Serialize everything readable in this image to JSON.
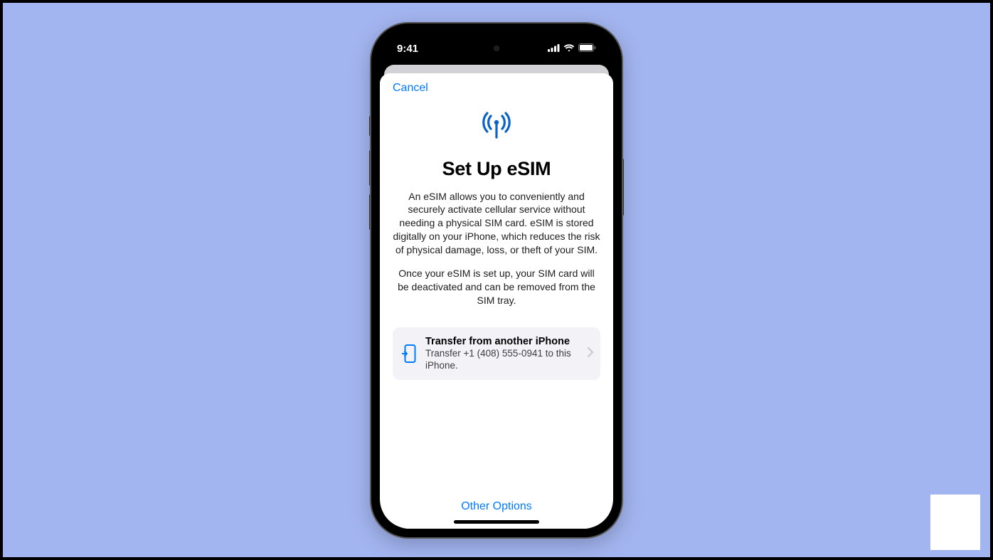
{
  "status_bar": {
    "time": "9:41"
  },
  "sheet": {
    "cancel_label": "Cancel",
    "title": "Set Up eSIM",
    "description1": "An eSIM allows you to conveniently and securely activate cellular service without needing a physical SIM card. eSIM is stored digitally on your iPhone, which reduces the risk of physical damage, loss, or theft of your SIM.",
    "description2": "Once your eSIM is set up, your SIM card will be deactivated and can be removed from the SIM tray.",
    "option": {
      "title": "Transfer from another iPhone",
      "subtitle": "Transfer +1 (408) 555-0941 to this iPhone."
    },
    "footer_link": "Other Options"
  }
}
